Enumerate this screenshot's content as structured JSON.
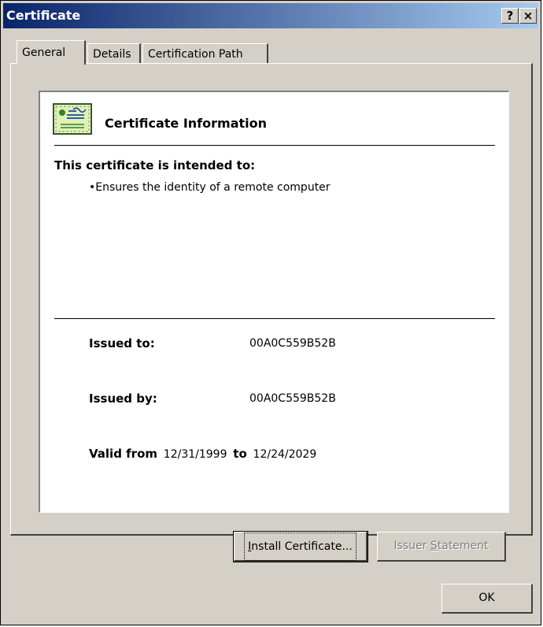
{
  "window": {
    "title": "Certificate",
    "help_button": "?",
    "close_button": "×"
  },
  "tabs": [
    {
      "label": "General",
      "active": true
    },
    {
      "label": "Details",
      "active": false
    },
    {
      "label": "Certification Path",
      "active": false
    }
  ],
  "cert_info": {
    "heading": "Certificate Information",
    "intended_label": "This certificate is intended to:",
    "purposes": [
      "•Ensures the identity of a remote computer"
    ],
    "issued_to_label": "Issued to:",
    "issued_to_value": "00A0C559B52B",
    "issued_by_label": "Issued by:",
    "issued_by_value": "00A0C559B52B",
    "valid_from_label": "Valid from",
    "valid_from_value": "12/31/1999",
    "valid_to_label": "to",
    "valid_to_value": "12/24/2029",
    "icon": "certificate-icon"
  },
  "buttons": {
    "install_first": "I",
    "install_rest": "nstall Certificate...",
    "issuer_pre": "Issuer ",
    "issuer_mnemonic": "S",
    "issuer_rest": "tatement",
    "ok": "OK"
  },
  "colors": {
    "titlebar_start": "#0a246a",
    "titlebar_end": "#a6caf0",
    "face": "#d4d0c8"
  }
}
